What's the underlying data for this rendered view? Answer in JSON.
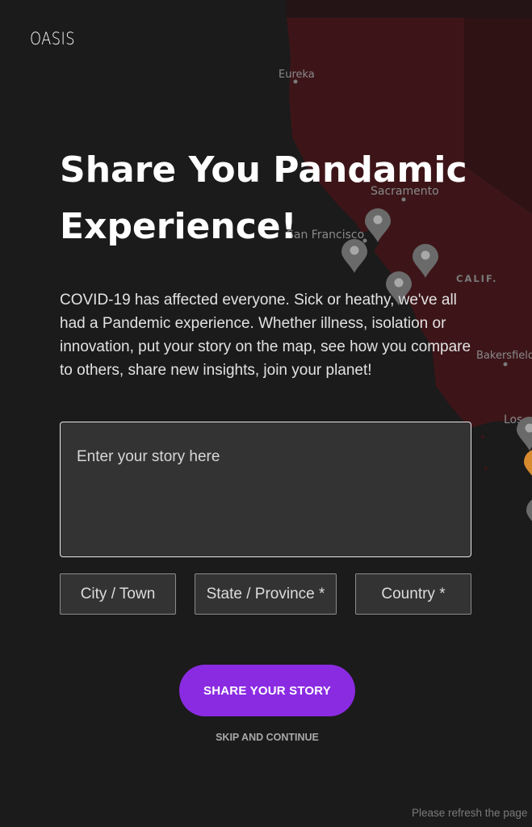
{
  "brand": {
    "logo": "OASIS"
  },
  "hero": {
    "title_line1": "Share You Pandamic",
    "title_line2": "Experience!",
    "intro": "COVID-19 has affected everyone. Sick or heathy, we've all had a Pandemic experience. Whether illness, isolation or innovation, put your story on the map, see how you compare to others, share new insights, join your planet!"
  },
  "form": {
    "story_placeholder": "Enter your story here",
    "city_placeholder": "City / Town",
    "state_placeholder": "State / Province *",
    "country_placeholder": "Country *",
    "submit_label": "SHARE YOUR STORY",
    "skip_label": "SKIP AND CONTINUE"
  },
  "map": {
    "labels": {
      "eureka": "Eureka",
      "sacramento": "Sacramento",
      "san_francisco": "San Francisco",
      "calif": "CALIF.",
      "bakersfield": "Bakersfield",
      "los_angeles": "Los"
    },
    "colors": {
      "state_fill": "#3d1518",
      "state_dark": "#2e1214",
      "pin": "#6a6a6a",
      "pin_highlight": "#d88a2f"
    }
  },
  "footer": {
    "refresh_notice": "Please refresh the page"
  },
  "theme": {
    "background": "#1b1b1b",
    "accent": "#8a2be2",
    "field_bg": "#333333"
  }
}
